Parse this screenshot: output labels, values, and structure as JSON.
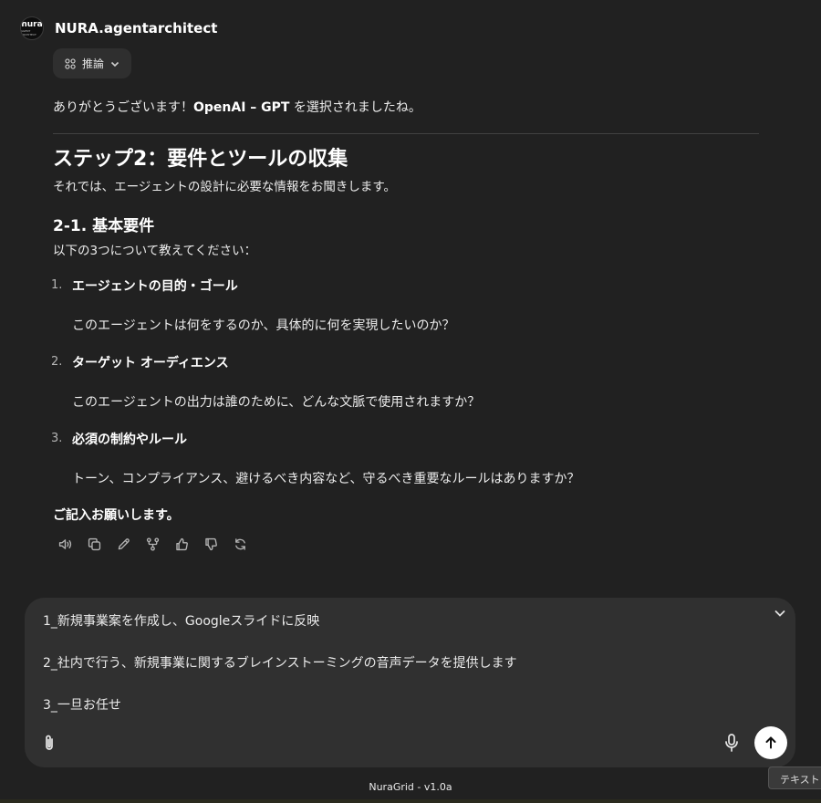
{
  "header": {
    "avatar_line1": "nura",
    "avatar_line2": "AGENT ARCHITECT",
    "agent_name": "NURA.agentarchitect"
  },
  "reasoning_button": {
    "label": "推論"
  },
  "message": {
    "intro_before": "ありがとうございます！",
    "intro_bold": "OpenAI – GPT",
    "intro_after": " を選択されましたね。",
    "heading": "ステップ2：要件とツールの収集",
    "heading_desc": "それでは、エージェントの設計に必要な情報をお聞きします。",
    "subheading": "2-1. 基本要件",
    "subheading_desc": "以下の3つについて教えてください：",
    "items": [
      {
        "number": "1.",
        "title": "エージェントの目的・ゴール",
        "desc": "このエージェントは何をするのか、具体的に何を実現したいのか？"
      },
      {
        "number": "2.",
        "title": "ターゲット オーディエンス",
        "desc": "このエージェントの出力は誰のために、どんな文脈で使用されますか？"
      },
      {
        "number": "3.",
        "title": "必須の制約やルール",
        "desc": "トーン、コンプライアンス、避けるべき内容など、守るべき重要なルールはありますか？"
      }
    ],
    "closing": "ご記入お願いします。"
  },
  "message_actions": [
    "speaker-icon",
    "copy-icon",
    "edit-icon",
    "branch-icon",
    "thumbs-up-icon",
    "thumbs-down-icon",
    "regenerate-icon"
  ],
  "composer": {
    "lines": [
      "1_新規事業案を作成し、Googleスライドに反映",
      "2_社内で行う、新規事業に関するブレインストーミングの音声データを提供します",
      "3_一旦お任せ"
    ]
  },
  "footer": {
    "version": "NuraGrid - v1.0a"
  },
  "tooltip": {
    "text": "テキスト"
  }
}
